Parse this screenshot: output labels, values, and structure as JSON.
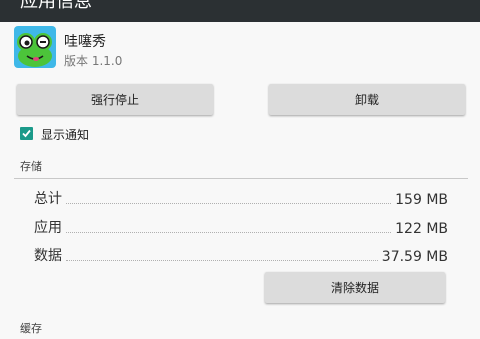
{
  "window": {
    "title": "应用信息"
  },
  "app": {
    "name": "哇噻秀",
    "version": "版本 1.1.0"
  },
  "buttons": {
    "force_stop": "强行停止",
    "uninstall": "卸载",
    "clear_data": "清除数据"
  },
  "notifications": {
    "label": "显示通知",
    "checked": true
  },
  "storage": {
    "title": "存储",
    "rows": [
      {
        "label": "总计",
        "value": "159 MB"
      },
      {
        "label": "应用",
        "value": "122 MB"
      },
      {
        "label": "数据",
        "value": "37.59 MB"
      }
    ]
  },
  "cache": {
    "title": "缓存"
  },
  "colors": {
    "accent": "#1b9a8a",
    "titlebar": "#2b3033",
    "button": "#dcdcdc",
    "app_icon_bg": "#3fb8e8",
    "app_icon_green": "#4cc43a"
  }
}
